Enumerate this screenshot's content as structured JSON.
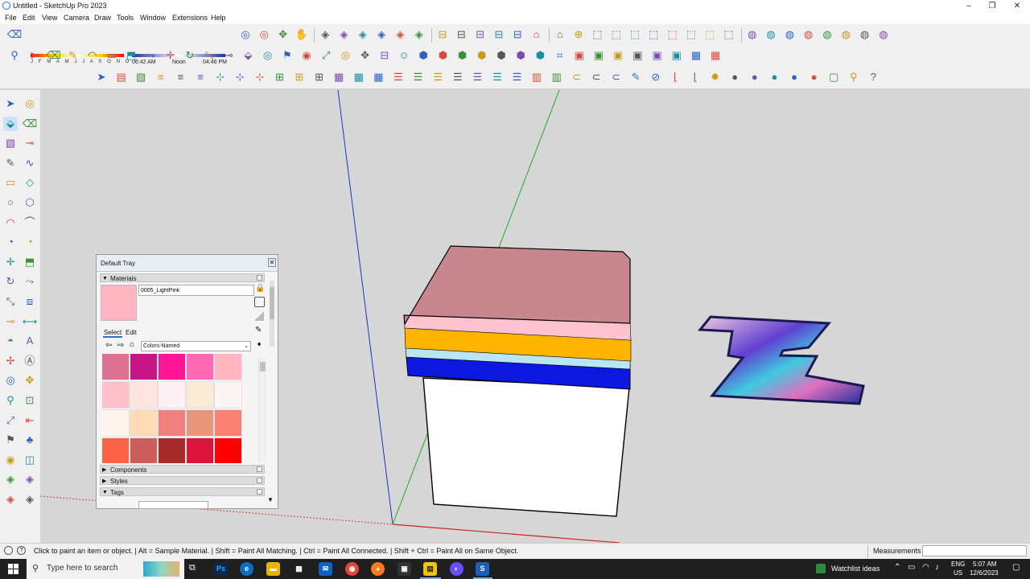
{
  "window": {
    "title": "Untitled - SketchUp Pro 2023",
    "min": "–",
    "max": "❐",
    "close": "✕"
  },
  "menu": [
    "File",
    "Edit",
    "View",
    "Camera",
    "Draw",
    "Tools",
    "Window",
    "Extensions",
    "Help"
  ],
  "shadow": {
    "months": "J F M A M J J A S O N D",
    "time_start": "06:42 AM",
    "time_mid": "Noon",
    "time_end": "04:46 PM"
  },
  "icons": {
    "row1": [
      "eraser-icon",
      "orbit-icon",
      "orbit-icon",
      "pan-icon",
      "hand-icon",
      "sandbox-icon",
      "sandbox-icon",
      "sandbox-icon",
      "sandbox-icon",
      "sandbox-icon",
      "sandbox-icon",
      "section-icon",
      "section-icon",
      "section-icon",
      "section-icon",
      "section-icon",
      "warehouse-icon",
      "warehouse-icon",
      "extension-icon",
      "view-icon",
      "view-icon",
      "view-icon",
      "view-icon",
      "view-icon",
      "view-icon",
      "view-icon",
      "view-icon",
      "style-icon",
      "style-icon",
      "style-icon",
      "style-icon",
      "style-icon",
      "style-icon",
      "style-icon",
      "style-icon"
    ],
    "row2": [
      "zoom-icon",
      "select-icon",
      "eraser-icon",
      "pencil-icon",
      "arc-icon",
      "rectangle-icon",
      "push-pull-icon",
      "follow-me-icon",
      "move-icon",
      "rotate-icon",
      "scale-icon",
      "tape-icon",
      "paint-bucket-icon",
      "orbit-icon",
      "walk-icon",
      "look-around-icon",
      "zoom-extents-icon",
      "orbit-icon",
      "pan-icon",
      "section-icon",
      "user-icon",
      "solid-tools-icon",
      "solid-tools-icon",
      "solid-tools-icon",
      "solid-tools-icon",
      "solid-tools-icon",
      "solid-tools-icon",
      "solid-tools-icon",
      "tag-icon",
      "cube-icon",
      "cube-icon",
      "cube-icon",
      "cube-icon",
      "cube-icon",
      "cube-icon",
      "grid-icon",
      "grid-icon"
    ],
    "row3": [
      "select-icon",
      "group-icon",
      "component-icon",
      "align-icon",
      "align-icon",
      "align-icon",
      "axis-icon",
      "axis-icon",
      "axis-icon",
      "array-icon",
      "array-icon",
      "array-icon",
      "grid-icon",
      "grid-icon",
      "grid-icon",
      "stack-icon",
      "stack-icon",
      "stack-icon",
      "stack-icon",
      "stack-icon",
      "stack-icon",
      "stack-icon",
      "layout-icon",
      "layout-icon",
      "pipe-icon",
      "pipe-icon",
      "pipe-icon",
      "pencil-icon",
      "erase-icon",
      "stair-icon",
      "stair-icon",
      "gear-icon",
      "sphere-icon",
      "sphere-icon",
      "sphere-icon",
      "sphere-icon",
      "sphere-icon",
      "highlight-icon",
      "pin-icon",
      "help-icon"
    ],
    "left": [
      "select-icon",
      "orbit-icon",
      "paint-bucket-icon",
      "eraser-icon",
      "component-icon",
      "tape-icon",
      "pencil-icon",
      "freehand-icon",
      "rectangle-icon",
      "rotated-rectangle-icon",
      "circle-icon",
      "polygon-icon",
      "arc-icon",
      "arc-3pt-icon",
      "pie-icon",
      "pie-icon",
      "move-icon",
      "push-pull-icon",
      "rotate-icon",
      "follow-me-icon",
      "scale-icon",
      "offset-icon",
      "tape-icon",
      "dimension-icon",
      "protractor-icon",
      "text-icon",
      "axes-icon",
      "3d-text-icon",
      "orbit-icon",
      "pan-icon",
      "zoom-icon",
      "zoom-window-icon",
      "zoom-extents-icon",
      "previous-view-icon",
      "walk-icon",
      "footprint-icon",
      "look-around-icon",
      "section-plane-icon",
      "sandbox-icon",
      "sandbox-icon",
      "sandbox-icon",
      "sandbox-icon"
    ]
  },
  "tray": {
    "title": "Default Tray",
    "close": "✕",
    "materials": {
      "label": "Materials",
      "current_name": "0005_LightPink",
      "current_color": "#ffb6c1",
      "tab_select": "Select",
      "tab_edit": "Edit",
      "library": "Colors-Named",
      "swatches": [
        "#db7093",
        "#c71585",
        "#ff1493",
        "#ff69b4",
        "#ffb6c1",
        "#ffc0cb",
        "#ffe4e1",
        "#fff0f5",
        "#faebd7",
        "#fdf5f5",
        "#fff5ee",
        "#ffdab9",
        "#f08080",
        "#e9967a",
        "#fa8072",
        "#ff6347",
        "#cd5c5c",
        "#a52a2a",
        "#dc143c",
        "#ff0000"
      ]
    },
    "components": "Components",
    "styles": "Styles",
    "tags": "Tags"
  },
  "colors": {
    "top_face": "#c8868f",
    "band_pink": "#ffc3d0",
    "band_orange": "#ffb400",
    "band_lightblue": "#b8e6f5",
    "band_blue": "#0c17e0",
    "body": "#ffffff",
    "accent": "#2a6fd6"
  },
  "status": {
    "message": "Click to paint an item or object. | Alt = Sample Material. | Shift = Paint All Matching. | Ctrl = Paint All Connected. | Shift + Ctrl = Paint All on Same Object.",
    "measurements_label": "Measurements",
    "measurements_value": ""
  },
  "taskbar": {
    "search_placeholder": "Type here to search",
    "widget": "Watchlist ideas",
    "lang": "ENG",
    "region": "US",
    "time": "5:07 AM",
    "date": "12/6/2023"
  }
}
